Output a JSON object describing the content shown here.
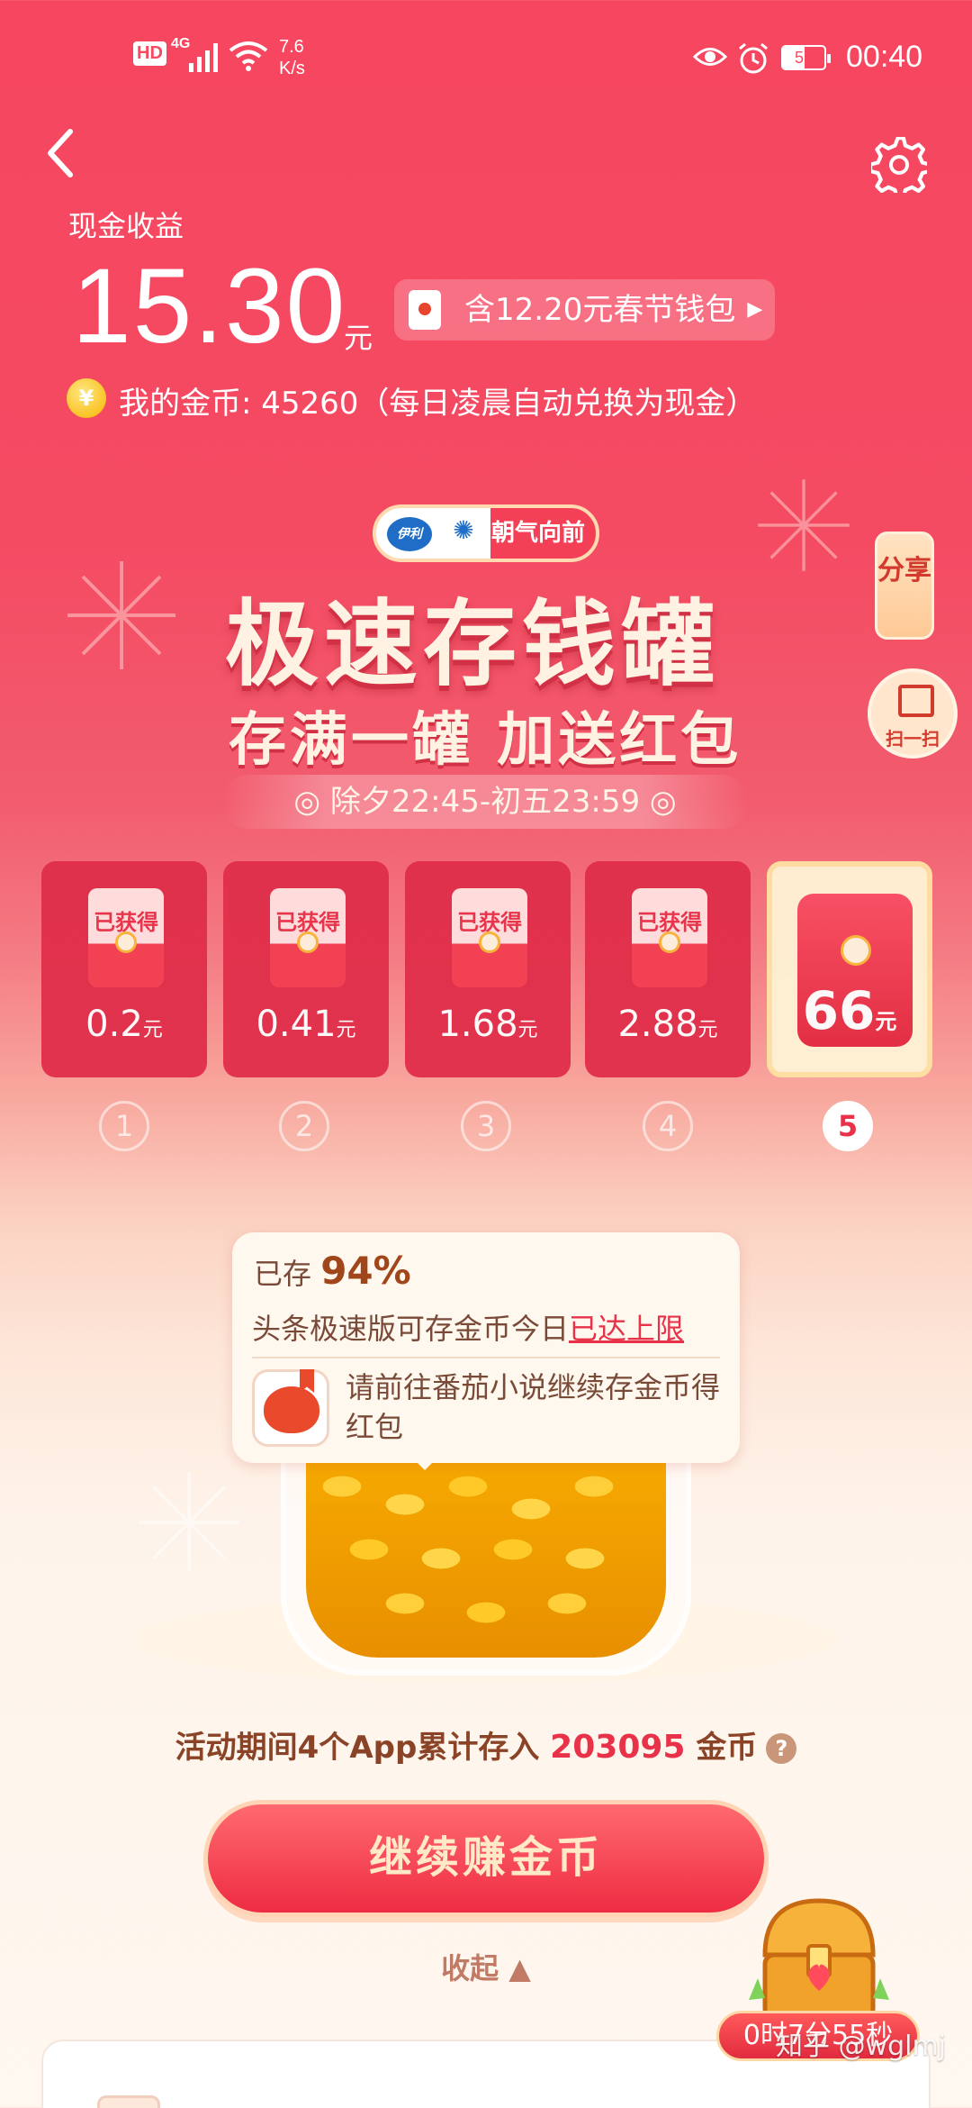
{
  "status_bar": {
    "net": "4G",
    "speed_value": "7.6",
    "speed_unit": "K/s",
    "battery": "52",
    "time": "00:40",
    "hd": "HD"
  },
  "header": {
    "cash_label": "现金收益",
    "cash_amount": "15.30",
    "cash_unit": "元",
    "cny_badge": "含12.20元春节钱包",
    "coins_text": "我的金币: 45260（每日凌晨自动兑换为现金）",
    "coin_symbol": "¥"
  },
  "banner": {
    "sponsor": "朝气向前",
    "sponsor_brand": "伊利",
    "title": "极速存钱罐",
    "subtitle": "存满一罐 加送红包",
    "period": "除夕22:45-初五23:59"
  },
  "side": {
    "share": "分享",
    "scan": "扫一扫"
  },
  "rewards": [
    {
      "status": "已获得",
      "value": "0.2",
      "unit": "元",
      "index": "1"
    },
    {
      "status": "已获得",
      "value": "0.41",
      "unit": "元",
      "index": "2"
    },
    {
      "status": "已获得",
      "value": "1.68",
      "unit": "元",
      "index": "3"
    },
    {
      "status": "已获得",
      "value": "2.88",
      "unit": "元",
      "index": "4"
    },
    {
      "status": "",
      "value": "66",
      "unit": "元",
      "index": "5"
    }
  ],
  "popup": {
    "saved_label": "已存",
    "saved_percent": "94%",
    "limit_text": "头条极速版可存金币今日",
    "limit_link": "已达上限",
    "hint": "请前往番茄小说继续存金币得红包"
  },
  "total": {
    "prefix": "活动期间4个App累计存入",
    "amount": "203095",
    "suffix": "金币",
    "help": "?"
  },
  "cta": {
    "label": "继续赚金币"
  },
  "collapse": {
    "label": "收起 ▲"
  },
  "timer": {
    "label": "0时7分55秒"
  },
  "watermark": "知乎 @wglmj",
  "colors": {
    "brand_red": "#f44a62",
    "accent_gold": "#ffd64a"
  }
}
